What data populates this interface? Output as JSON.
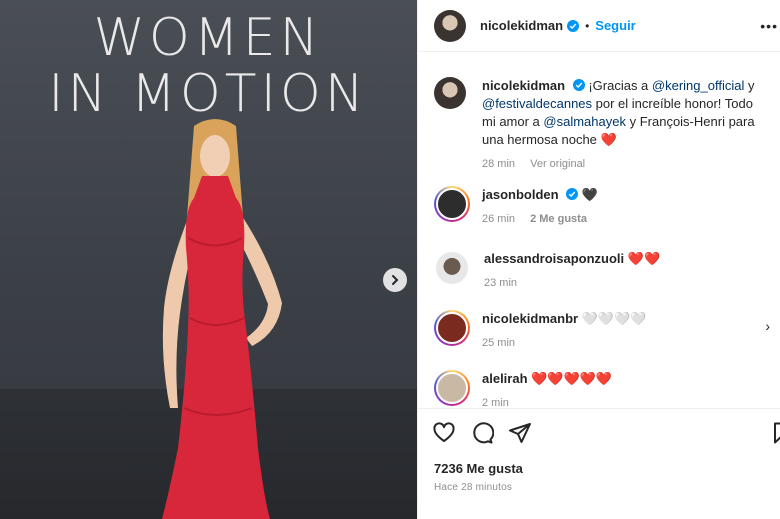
{
  "photo": {
    "wall_line1": "WOMEN",
    "wall_line2": "IN MOTION",
    "next_icon": "chevron-right-icon"
  },
  "header": {
    "username": "nicolekidman",
    "separator": "•",
    "follow_label": "Seguir",
    "more_label": "•••"
  },
  "caption": {
    "username": "nicolekidman",
    "text_1": "¡Gracias a ",
    "mention_1": "@kering_official",
    "text_2": " y ",
    "mention_2": "@festivaldecannes",
    "text_3": " por el increíble honor! Todo mi amor a ",
    "mention_3": "@salmahayek",
    "text_4": " y François-Henri para una hermosa noche ",
    "emoji": "❤️",
    "time": "28 min",
    "translation": "Ver original"
  },
  "comments": [
    {
      "username": "jasonbolden",
      "text": "🖤",
      "time": "26 min",
      "likes": "2 Me gusta",
      "reply": ""
    },
    {
      "username": "alessandroisaponzuoli",
      "text": "❤️❤️",
      "time": "23 min",
      "likes": "",
      "reply": ""
    },
    {
      "username": "nicolekidmanbr",
      "text": "🤍🤍🤍🤍",
      "time": "25 min",
      "likes": "",
      "reply": ""
    },
    {
      "username": "alelirah",
      "text": "❤️❤️❤️❤️❤️",
      "time": "2 min",
      "likes": "",
      "reply": ""
    }
  ],
  "footer": {
    "likes": "7236 Me gusta",
    "posted": "Hace 28 minutos"
  },
  "colors": {
    "accent": "#0095f6",
    "mention": "#00376b",
    "heart": "#ed4956",
    "dress": "#d8263a"
  }
}
